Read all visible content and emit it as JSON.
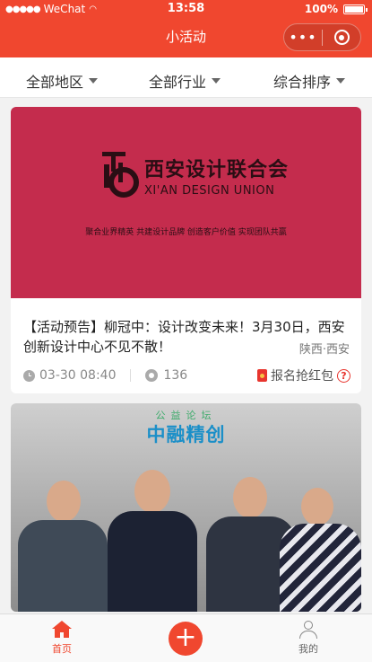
{
  "status_bar": {
    "carrier": "WeChat",
    "time": "13:58",
    "battery": "100%"
  },
  "nav": {
    "title": "小活动",
    "more_icon": "more-dots-icon",
    "close_icon": "close-circle-icon"
  },
  "filters": [
    {
      "label": "全部地区"
    },
    {
      "label": "全部行业"
    },
    {
      "label": "综合排序"
    }
  ],
  "cards": [
    {
      "banner": {
        "org_cn": "西安设计联合会",
        "org_en": "XI'AN DESIGN UNION",
        "slogan": "聚合业界精英   共建设计品牌   创造客户价值   实现团队共赢",
        "bg_color": "#c42c4d"
      },
      "title": "【活动预告】柳冠中：设计改变未来！3月30日，西安创新设计中心不见不散！",
      "location": "陕西·西安",
      "datetime": "03-30 08:40",
      "views": "136",
      "redpack_label": "报名抢红包"
    },
    {
      "banner": {
        "subtitle": "公益论坛",
        "title": "中融精创"
      }
    }
  ],
  "tabbar": {
    "home_label": "首页",
    "add_label": "+",
    "me_label": "我的"
  },
  "colors": {
    "accent": "#f0472f"
  }
}
